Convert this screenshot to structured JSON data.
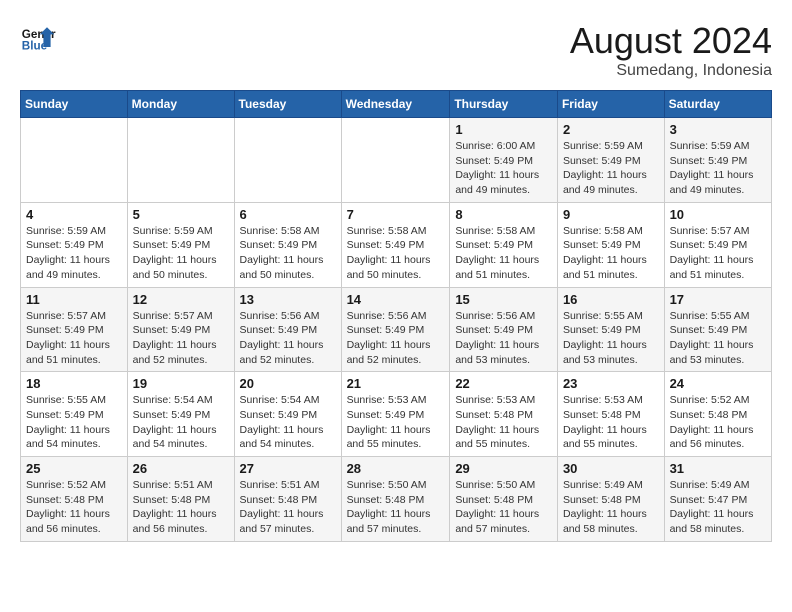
{
  "header": {
    "logo_line1": "General",
    "logo_line2": "Blue",
    "month": "August 2024",
    "location": "Sumedang, Indonesia"
  },
  "weekdays": [
    "Sunday",
    "Monday",
    "Tuesday",
    "Wednesday",
    "Thursday",
    "Friday",
    "Saturday"
  ],
  "weeks": [
    [
      {
        "day": "",
        "info": ""
      },
      {
        "day": "",
        "info": ""
      },
      {
        "day": "",
        "info": ""
      },
      {
        "day": "",
        "info": ""
      },
      {
        "day": "1",
        "info": "Sunrise: 6:00 AM\nSunset: 5:49 PM\nDaylight: 11 hours\nand 49 minutes."
      },
      {
        "day": "2",
        "info": "Sunrise: 5:59 AM\nSunset: 5:49 PM\nDaylight: 11 hours\nand 49 minutes."
      },
      {
        "day": "3",
        "info": "Sunrise: 5:59 AM\nSunset: 5:49 PM\nDaylight: 11 hours\nand 49 minutes."
      }
    ],
    [
      {
        "day": "4",
        "info": "Sunrise: 5:59 AM\nSunset: 5:49 PM\nDaylight: 11 hours\nand 49 minutes."
      },
      {
        "day": "5",
        "info": "Sunrise: 5:59 AM\nSunset: 5:49 PM\nDaylight: 11 hours\nand 50 minutes."
      },
      {
        "day": "6",
        "info": "Sunrise: 5:58 AM\nSunset: 5:49 PM\nDaylight: 11 hours\nand 50 minutes."
      },
      {
        "day": "7",
        "info": "Sunrise: 5:58 AM\nSunset: 5:49 PM\nDaylight: 11 hours\nand 50 minutes."
      },
      {
        "day": "8",
        "info": "Sunrise: 5:58 AM\nSunset: 5:49 PM\nDaylight: 11 hours\nand 51 minutes."
      },
      {
        "day": "9",
        "info": "Sunrise: 5:58 AM\nSunset: 5:49 PM\nDaylight: 11 hours\nand 51 minutes."
      },
      {
        "day": "10",
        "info": "Sunrise: 5:57 AM\nSunset: 5:49 PM\nDaylight: 11 hours\nand 51 minutes."
      }
    ],
    [
      {
        "day": "11",
        "info": "Sunrise: 5:57 AM\nSunset: 5:49 PM\nDaylight: 11 hours\nand 51 minutes."
      },
      {
        "day": "12",
        "info": "Sunrise: 5:57 AM\nSunset: 5:49 PM\nDaylight: 11 hours\nand 52 minutes."
      },
      {
        "day": "13",
        "info": "Sunrise: 5:56 AM\nSunset: 5:49 PM\nDaylight: 11 hours\nand 52 minutes."
      },
      {
        "day": "14",
        "info": "Sunrise: 5:56 AM\nSunset: 5:49 PM\nDaylight: 11 hours\nand 52 minutes."
      },
      {
        "day": "15",
        "info": "Sunrise: 5:56 AM\nSunset: 5:49 PM\nDaylight: 11 hours\nand 53 minutes."
      },
      {
        "day": "16",
        "info": "Sunrise: 5:55 AM\nSunset: 5:49 PM\nDaylight: 11 hours\nand 53 minutes."
      },
      {
        "day": "17",
        "info": "Sunrise: 5:55 AM\nSunset: 5:49 PM\nDaylight: 11 hours\nand 53 minutes."
      }
    ],
    [
      {
        "day": "18",
        "info": "Sunrise: 5:55 AM\nSunset: 5:49 PM\nDaylight: 11 hours\nand 54 minutes."
      },
      {
        "day": "19",
        "info": "Sunrise: 5:54 AM\nSunset: 5:49 PM\nDaylight: 11 hours\nand 54 minutes."
      },
      {
        "day": "20",
        "info": "Sunrise: 5:54 AM\nSunset: 5:49 PM\nDaylight: 11 hours\nand 54 minutes."
      },
      {
        "day": "21",
        "info": "Sunrise: 5:53 AM\nSunset: 5:49 PM\nDaylight: 11 hours\nand 55 minutes."
      },
      {
        "day": "22",
        "info": "Sunrise: 5:53 AM\nSunset: 5:48 PM\nDaylight: 11 hours\nand 55 minutes."
      },
      {
        "day": "23",
        "info": "Sunrise: 5:53 AM\nSunset: 5:48 PM\nDaylight: 11 hours\nand 55 minutes."
      },
      {
        "day": "24",
        "info": "Sunrise: 5:52 AM\nSunset: 5:48 PM\nDaylight: 11 hours\nand 56 minutes."
      }
    ],
    [
      {
        "day": "25",
        "info": "Sunrise: 5:52 AM\nSunset: 5:48 PM\nDaylight: 11 hours\nand 56 minutes."
      },
      {
        "day": "26",
        "info": "Sunrise: 5:51 AM\nSunset: 5:48 PM\nDaylight: 11 hours\nand 56 minutes."
      },
      {
        "day": "27",
        "info": "Sunrise: 5:51 AM\nSunset: 5:48 PM\nDaylight: 11 hours\nand 57 minutes."
      },
      {
        "day": "28",
        "info": "Sunrise: 5:50 AM\nSunset: 5:48 PM\nDaylight: 11 hours\nand 57 minutes."
      },
      {
        "day": "29",
        "info": "Sunrise: 5:50 AM\nSunset: 5:48 PM\nDaylight: 11 hours\nand 57 minutes."
      },
      {
        "day": "30",
        "info": "Sunrise: 5:49 AM\nSunset: 5:48 PM\nDaylight: 11 hours\nand 58 minutes."
      },
      {
        "day": "31",
        "info": "Sunrise: 5:49 AM\nSunset: 5:47 PM\nDaylight: 11 hours\nand 58 minutes."
      }
    ]
  ]
}
